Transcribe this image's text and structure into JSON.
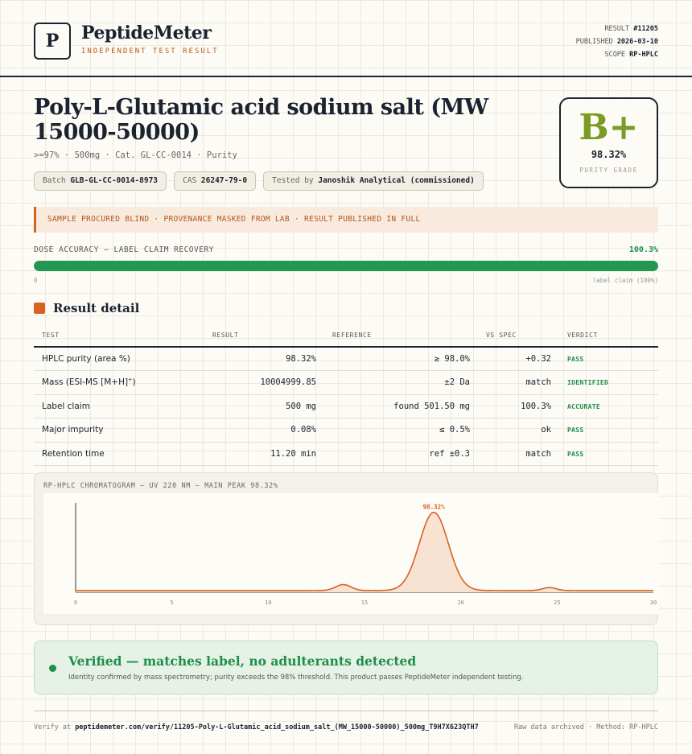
{
  "brand": {
    "logo_letter": "P",
    "name": "PeptideMeter",
    "tagline": "INDEPENDENT TEST RESULT"
  },
  "meta": {
    "result_label": "RESULT",
    "result_value": "#11205",
    "published_label": "PUBLISHED",
    "published_value": "2026-03-10",
    "scope_label": "SCOPE",
    "scope_value": "RP-HPLC"
  },
  "product": {
    "title": "Poly-L-Glutamic acid sodium salt (MW 15000-50000)",
    "subline": ">=97% · 500mg · Cat. GL-CC-0014 · Purity",
    "chips": [
      {
        "label": "Batch",
        "value": "GLB-GL-CC-0014-8973"
      },
      {
        "label": "CAS",
        "value": "26247-79-0"
      },
      {
        "label": "Tested by",
        "value": "Janoshik Analytical (commissioned)"
      }
    ]
  },
  "grade": {
    "letter": "B+",
    "value": "98.32%",
    "label": "PURITY GRADE",
    "color": "#7a9b24"
  },
  "banner": "SAMPLE PROCURED BLIND · PROVENANCE MASKED FROM LAB · RESULT PUBLISHED IN FULL",
  "dose": {
    "label": "DOSE ACCURACY — LABEL CLAIM RECOVERY",
    "value": "100.3%",
    "fill_fraction": 1.0,
    "min_label": "0",
    "max_label": "label claim (100%)"
  },
  "section_title": "Result detail",
  "table": {
    "headers": [
      "TEST",
      "RESULT",
      "REFERENCE",
      "VS SPEC",
      "VERDICT"
    ],
    "rows": [
      {
        "test": "HPLC purity (area %)",
        "result": "98.32%",
        "reference": "≥ 98.0%",
        "vs_spec": "+0.32",
        "verdict": "PASS"
      },
      {
        "test": "Mass (ESI-MS [M+H]",
        "test_sup": "+",
        "test_end": ")",
        "result": "10004999.85",
        "reference": "±2 Da",
        "vs_spec": "match",
        "verdict": "IDENTIFIED"
      },
      {
        "test": "Label claim",
        "result": "500 mg",
        "reference": "found 501.50 mg",
        "vs_spec": "100.3%",
        "verdict": "ACCURATE"
      },
      {
        "test": "Major impurity",
        "result": "0.08%",
        "reference": "≤ 0.5%",
        "vs_spec": "ok",
        "verdict": "PASS"
      },
      {
        "test": "Retention time",
        "result": "11.20 min",
        "reference": "ref ±0.3",
        "vs_spec": "match",
        "verdict": "PASS"
      }
    ]
  },
  "chart_data": {
    "type": "line",
    "title": "RP-HPLC CHROMATOGRAM — UV 220 NM — MAIN PEAK 98.32%",
    "xlabel": "",
    "ylabel": "",
    "x_ticks": [
      0,
      5,
      10,
      15,
      20,
      25,
      30
    ],
    "x_tick_labels": [
      "0",
      "5",
      "10",
      "15",
      "20",
      "25",
      "30"
    ],
    "xlim": [
      0,
      30
    ],
    "ylim": [
      0,
      1.05
    ],
    "peaks": [
      {
        "center": 13.9,
        "height": 0.07,
        "width": 0.4
      },
      {
        "center": 18.6,
        "height": 0.92,
        "width": 0.75
      },
      {
        "center": 24.6,
        "height": 0.035,
        "width": 0.35
      }
    ],
    "baseline": 0.02,
    "annotation": {
      "x": 18.6,
      "text": "98.32%"
    },
    "line_color": "#d8621f",
    "fill_color": "#f8e2d2"
  },
  "verified": {
    "title": "Verified — matches label, no adulterants detected",
    "subtitle": "Identity confirmed by mass spectrometry; purity exceeds the 98% threshold. This product passes PeptideMeter independent testing."
  },
  "footer": {
    "verify_prefix": "Verify at",
    "verify_url": "peptidemeter.com/verify/11205-Poly-L-Glutamic_acid_sodium_salt_(MW_15000-50000)_500mg_T9H7X623QTH7",
    "right": "Raw data archived · Method: RP-HPLC"
  }
}
